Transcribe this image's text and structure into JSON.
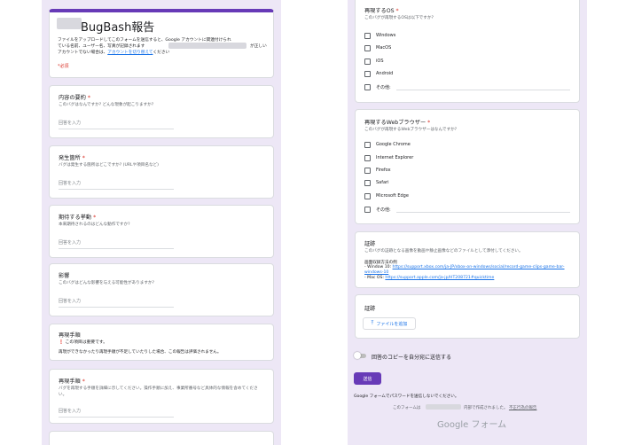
{
  "form": {
    "title": "BugBash報告",
    "description_line1": "ファイルをアップロードしてこのフォームを送信すると、Google アカウントに関連付けられ",
    "description_line2": "ている名前、ユーザー名、写真が記録されます",
    "description_line2_suffix": "が正しい",
    "description_line3_prefix": "アカウントでない場合は、",
    "switch_account_link": "アカウントを切り替えて",
    "description_line3_suffix": "ください",
    "required_note": "*必須"
  },
  "questions_left": [
    {
      "title": "内容の要約",
      "required": "*",
      "desc": "このバグはなんですか? どんな現象が起こりますか?",
      "placeholder": "回答を入力"
    },
    {
      "title": "発生箇所",
      "required": "*",
      "desc": "バグは発生する箇所はどこですか? (URLや項目名など)",
      "placeholder": "回答を入力"
    },
    {
      "title": "期待する挙動",
      "required": "*",
      "desc": "本来期待されるのはどんな動作ですか?",
      "placeholder": "回答を入力"
    },
    {
      "title": "影響",
      "required": "",
      "desc": "このバグはどんな影響を与える可能性がありますか?",
      "placeholder": "回答を入力"
    }
  ],
  "repro_notice": {
    "title": "再現手順",
    "warning": "この項目は重要です。",
    "body": "再現ができなかったり再現手順が不足していたりした場合、この報告は評価されません。"
  },
  "repro_steps": {
    "title": "再現手順",
    "required": "*",
    "desc_line1": "バグを再現する手順を詳細に示してください。操作手順に加え、事業所番号など具体的な情報を含めてくださ",
    "desc_line2": "い。",
    "placeholder": "回答を入力"
  },
  "os_question": {
    "title": "再現するOS",
    "required": "*",
    "desc": "このバグが再現するOSは以下ですか?",
    "options": [
      "Windows",
      "MacOS",
      "iOS",
      "Android"
    ],
    "other": "その他:"
  },
  "browser_question": {
    "title": "再現するWebブラウザー",
    "required": "*",
    "desc": "このバグが再現するWebブラウザーはなんですか?",
    "options": [
      "Google Chrome",
      "Internet Explorer",
      "Firefox",
      "Safari",
      "Microsoft Edge"
    ],
    "other": "その他:"
  },
  "evidence": {
    "title": "証跡",
    "desc": "このバグの証跡となる画像を動画や静止画像などのファイルとして添付してください。",
    "howto": "画面収録方法の例",
    "win_prefix": "- Window 10: ",
    "win_link_1": "https://support.xbox.com/ja-JP/xbox-on-windows/social/record-game-clips-game-bar-",
    "win_link_2": "windows-10",
    "mac_prefix": "- Mac OS: ",
    "mac_link": "https://support.apple.com/ja-jp/HT208721#quicktime"
  },
  "upload": {
    "title": "証跡",
    "button_label": "ファイルを追加"
  },
  "copy_toggle_label": "回答のコピーを自分宛に送信する",
  "submit_label": "送信",
  "password_warning": "Google フォームでパスワードを送信しないでください。",
  "footer_prefix": "このフォームは",
  "footer_middle": "内部で作成されました。",
  "footer_link": "不正行為の報告",
  "google_forms_logo": "Google フォーム",
  "colors": {
    "accent": "#673ab7",
    "background": "#ede7f6",
    "required": "#d93025",
    "link": "#1a73e8"
  }
}
